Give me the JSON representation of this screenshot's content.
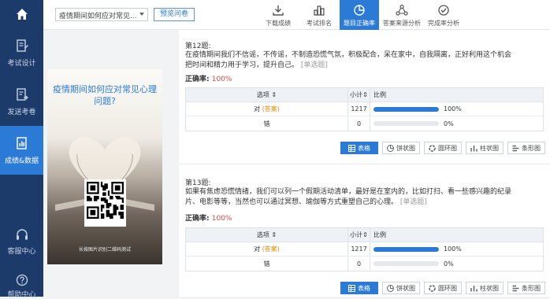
{
  "sidebar": {
    "items": [
      {
        "label": "考试设计"
      },
      {
        "label": "发送考卷"
      },
      {
        "label": "成绩&数据"
      }
    ],
    "bottom": [
      {
        "label": "客服中心"
      },
      {
        "label": "帮助中心"
      }
    ]
  },
  "topbar": {
    "survey_name": "疫情期间如何应对常见...",
    "preview_label": "预览问卷",
    "tools": [
      {
        "label": "下载成绩",
        "icon": "download-icon"
      },
      {
        "label": "考试排名",
        "icon": "ranking-icon"
      },
      {
        "label": "题目正确率",
        "icon": "pie-icon"
      },
      {
        "label": "答案来源分析",
        "icon": "share-icon"
      },
      {
        "label": "完成率分析",
        "icon": "check-circle-icon"
      }
    ]
  },
  "poster": {
    "title_line1": "疫情期间如何应对常见心理",
    "title_line2": "问题?",
    "caption": "长按图片识别二维码测试"
  },
  "questions": [
    {
      "title": "第12题:",
      "text": "在疫情期间我们不信谣，不传谣，不制造恐慌气氛，积极配合，呆在家中，自我隔离，正好利用这个机会把时间和精力用于学习，提升自己。",
      "type": "[单选题]",
      "rate_label": "正确率:",
      "rate_value": "100%",
      "header": {
        "option": "选项",
        "count": "小计",
        "pct": "比例"
      },
      "rows": [
        {
          "option": "对",
          "answer_tag": "(答案)",
          "count": "1217",
          "pct": "100%",
          "fill": 100
        },
        {
          "option": "错",
          "answer_tag": "",
          "count": "0",
          "pct": "0%",
          "fill": 0
        }
      ]
    },
    {
      "title": "第13题:",
      "text": "如果有焦虑恐慌情绪，我们可以列一个假期活动清单，最好是在室内的，比如打扫、看一些感兴趣的纪录片、电影等等，当然也可以通过冥想、瑜伽等方式重塑自己的心理。",
      "type": "[单选题]",
      "rate_label": "正确率:",
      "rate_value": "100%",
      "header": {
        "option": "选项",
        "count": "小计",
        "pct": "比例"
      },
      "rows": [
        {
          "option": "对",
          "answer_tag": "(答案)",
          "count": "1217",
          "pct": "100%",
          "fill": 100
        },
        {
          "option": "错",
          "answer_tag": "",
          "count": "0",
          "pct": "0%",
          "fill": 0
        }
      ]
    }
  ],
  "view_buttons": [
    "表格",
    "饼状图",
    "圆环图",
    "柱状图",
    "条形图"
  ],
  "colors": {
    "accent": "#2a7ad6",
    "sidebar": "#1c3b6a",
    "answer": "#e08b00",
    "rate": "#e04848"
  }
}
